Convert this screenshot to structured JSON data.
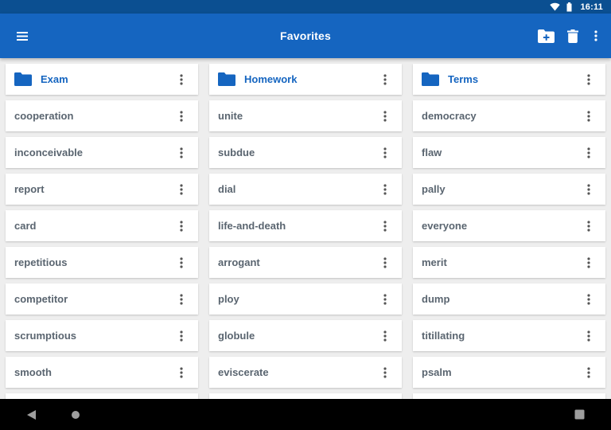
{
  "status_bar": {
    "time": "16:11",
    "icons": [
      "wifi-icon",
      "battery-icon"
    ]
  },
  "app_bar": {
    "title": "Favorites",
    "icons": [
      "menu-icon",
      "new-folder-icon",
      "delete-icon",
      "more-vert-icon"
    ]
  },
  "colors": {
    "status_bar": "#0b4f91",
    "app_bar": "#1565c0",
    "folder_accent": "#1565c0",
    "item_text": "#5a6570",
    "background": "#eeeeee",
    "card": "#ffffff"
  },
  "columns": [
    {
      "folder": {
        "name": "Exam",
        "icon": "folder-icon"
      },
      "items": [
        "cooperation",
        "inconceivable",
        "report",
        "card",
        "repetitious",
        "competitor",
        "scrumptious",
        "smooth"
      ]
    },
    {
      "folder": {
        "name": "Homework",
        "icon": "folder-icon"
      },
      "items": [
        "unite",
        "subdue",
        "dial",
        "life-and-death",
        "arrogant",
        "ploy",
        "globule",
        "eviscerate"
      ]
    },
    {
      "folder": {
        "name": "Terms",
        "icon": "folder-icon"
      },
      "items": [
        "democracy",
        "flaw",
        "pally",
        "everyone",
        "merit",
        "dump",
        "titillating",
        "psalm"
      ]
    }
  ],
  "nav_bar": {
    "icons": [
      "back-icon",
      "home-icon",
      "recents-icon"
    ]
  }
}
